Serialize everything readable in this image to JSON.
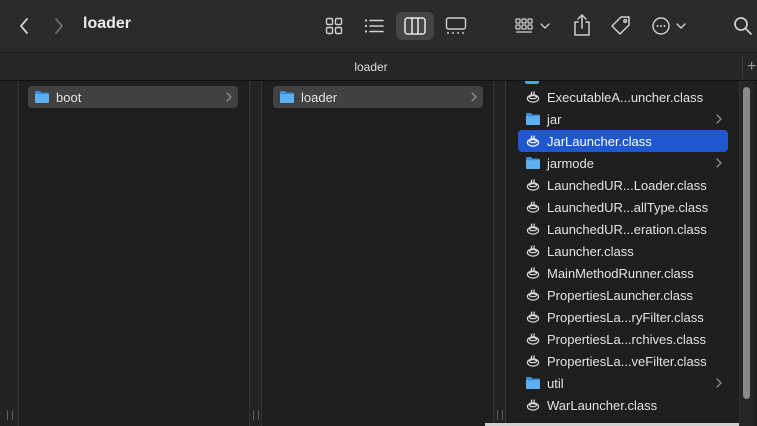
{
  "toolbar": {
    "title": "loader",
    "icons": [
      "chevron-left-icon",
      "chevron-right-icon",
      "grid-view-icon",
      "list-view-icon",
      "column-view-icon",
      "gallery-view-icon",
      "group-icon",
      "share-icon",
      "tag-icon",
      "more-icon",
      "search-icon"
    ]
  },
  "tab": {
    "title": "loader",
    "add_label": "+"
  },
  "columns": {
    "col1": {
      "items": [
        {
          "name": "boot",
          "kind": "folder",
          "state": "dimsel"
        }
      ]
    },
    "col2": {
      "items": [
        {
          "name": "loader",
          "kind": "folder",
          "state": "dimsel"
        }
      ]
    },
    "col3": {
      "items": [
        {
          "name": "ExecutableA...uncher.class",
          "kind": "class"
        },
        {
          "name": "jar",
          "kind": "folder"
        },
        {
          "name": "JarLauncher.class",
          "kind": "class",
          "state": "selected"
        },
        {
          "name": "jarmode",
          "kind": "folder"
        },
        {
          "name": "LaunchedUR...Loader.class",
          "kind": "class"
        },
        {
          "name": "LaunchedUR...allType.class",
          "kind": "class"
        },
        {
          "name": "LaunchedUR...eration.class",
          "kind": "class"
        },
        {
          "name": "Launcher.class",
          "kind": "class"
        },
        {
          "name": "MainMethodRunner.class",
          "kind": "class"
        },
        {
          "name": "PropertiesLauncher.class",
          "kind": "class"
        },
        {
          "name": "PropertiesLa...ryFilter.class",
          "kind": "class"
        },
        {
          "name": "PropertiesLa...rchives.class",
          "kind": "class"
        },
        {
          "name": "PropertiesLa...veFilter.class",
          "kind": "class"
        },
        {
          "name": "util",
          "kind": "folder"
        },
        {
          "name": "WarLauncher.class",
          "kind": "class"
        }
      ]
    }
  },
  "colors": {
    "selection": "#1f57d1",
    "folder": "#4aa3ec"
  }
}
